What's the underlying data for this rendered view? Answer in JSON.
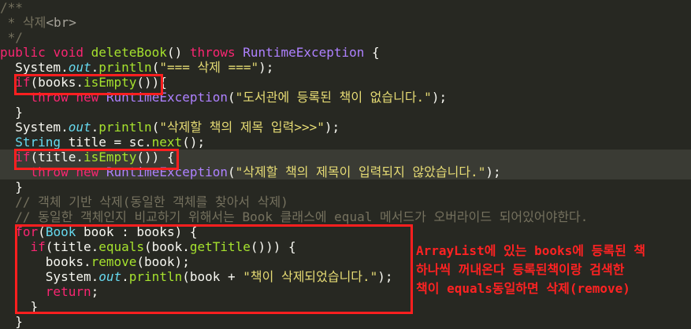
{
  "code_lines": [
    "/**",
    " * 삭제<br>",
    " */",
    "public void deleteBook() throws RuntimeException {",
    "  System.out.println(\"=== 삭제 ===\");",
    "  if(books.isEmpty()){",
    "    throw new RuntimeException(\"도서관에 등록된 책이 없습니다.\");",
    "  }",
    "  System.out.println(\"삭제할 책의 제목 입력>>>\");",
    "  String title = sc.next();",
    "  if(title.isEmpty()) {",
    "    throw new RuntimeException(\"삭제할 책의 제목이 입력되지 않았습니다.\");",
    "  }",
    "  // 객체 기반 삭제(동일한 객체를 찾아서 삭제)",
    "  // 동일한 객체인지 비교하기 위해서는 Book 클래스에 equal 메서드가 오버라이드 되어있어야한다.",
    "  for(Book book : books) {",
    "    if(title.equals(book.getTitle())) {",
    "      books.remove(book);",
    "      System.out.println(book + \"책이 삭제되었습니다.\");",
    "      return;",
    "    }",
    "  }"
  ],
  "annotation": {
    "lines": [
      "ArrayList에 있는 books에 등록된 책",
      "하나씩 꺼내온다 등록된책이랑 검색한",
      "책이 equals동일하면 삭제(remove)"
    ],
    "color": "#ff2222"
  },
  "theme": {
    "background": "#272822",
    "highlight_line": "#3a3b34",
    "box_color": "#ff1f1f"
  }
}
